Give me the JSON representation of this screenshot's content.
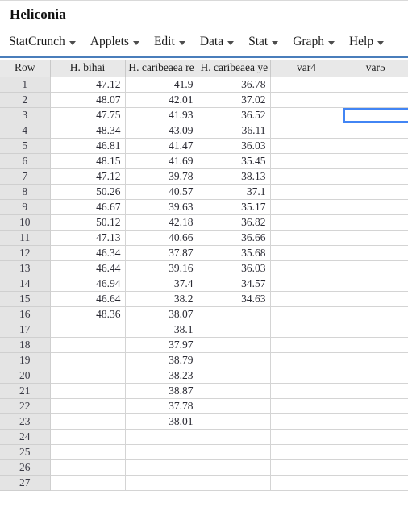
{
  "window": {
    "title": "Heliconia"
  },
  "menu": {
    "items": [
      {
        "label": "StatCrunch",
        "icon": "chevron-down-icon"
      },
      {
        "label": "Applets",
        "icon": "chevron-down-icon"
      },
      {
        "label": "Edit",
        "icon": "chevron-down-icon"
      },
      {
        "label": "Data",
        "icon": "chevron-down-icon"
      },
      {
        "label": "Stat",
        "icon": "chevron-down-icon"
      },
      {
        "label": "Graph",
        "icon": "chevron-down-icon"
      },
      {
        "label": "Help",
        "icon": "chevron-down-icon"
      }
    ]
  },
  "colors": {
    "accent": "#4a7ebb",
    "selection": "#4285f4",
    "header_bg": "#e8e8e8",
    "rownum_bg": "#e4e4e4",
    "grid_line": "#d4d4d4"
  },
  "spreadsheet": {
    "columns": [
      "Row",
      "H. bihai",
      "H. caribeaea re",
      "H. caribeaea ye",
      "var4",
      "var5"
    ],
    "selected_cell": {
      "row": 3,
      "column": "var5"
    },
    "rows": [
      {
        "n": "1",
        "c1": "47.12",
        "c2": "41.9",
        "c3": "36.78",
        "c4": "",
        "c5": ""
      },
      {
        "n": "2",
        "c1": "48.07",
        "c2": "42.01",
        "c3": "37.02",
        "c4": "",
        "c5": ""
      },
      {
        "n": "3",
        "c1": "47.75",
        "c2": "41.93",
        "c3": "36.52",
        "c4": "",
        "c5": ""
      },
      {
        "n": "4",
        "c1": "48.34",
        "c2": "43.09",
        "c3": "36.11",
        "c4": "",
        "c5": ""
      },
      {
        "n": "5",
        "c1": "46.81",
        "c2": "41.47",
        "c3": "36.03",
        "c4": "",
        "c5": ""
      },
      {
        "n": "6",
        "c1": "48.15",
        "c2": "41.69",
        "c3": "35.45",
        "c4": "",
        "c5": ""
      },
      {
        "n": "7",
        "c1": "47.12",
        "c2": "39.78",
        "c3": "38.13",
        "c4": "",
        "c5": ""
      },
      {
        "n": "8",
        "c1": "50.26",
        "c2": "40.57",
        "c3": "37.1",
        "c4": "",
        "c5": ""
      },
      {
        "n": "9",
        "c1": "46.67",
        "c2": "39.63",
        "c3": "35.17",
        "c4": "",
        "c5": ""
      },
      {
        "n": "10",
        "c1": "50.12",
        "c2": "42.18",
        "c3": "36.82",
        "c4": "",
        "c5": ""
      },
      {
        "n": "11",
        "c1": "47.13",
        "c2": "40.66",
        "c3": "36.66",
        "c4": "",
        "c5": ""
      },
      {
        "n": "12",
        "c1": "46.34",
        "c2": "37.87",
        "c3": "35.68",
        "c4": "",
        "c5": ""
      },
      {
        "n": "13",
        "c1": "46.44",
        "c2": "39.16",
        "c3": "36.03",
        "c4": "",
        "c5": ""
      },
      {
        "n": "14",
        "c1": "46.94",
        "c2": "37.4",
        "c3": "34.57",
        "c4": "",
        "c5": ""
      },
      {
        "n": "15",
        "c1": "46.64",
        "c2": "38.2",
        "c3": "34.63",
        "c4": "",
        "c5": ""
      },
      {
        "n": "16",
        "c1": "48.36",
        "c2": "38.07",
        "c3": "",
        "c4": "",
        "c5": ""
      },
      {
        "n": "17",
        "c1": "",
        "c2": "38.1",
        "c3": "",
        "c4": "",
        "c5": ""
      },
      {
        "n": "18",
        "c1": "",
        "c2": "37.97",
        "c3": "",
        "c4": "",
        "c5": ""
      },
      {
        "n": "19",
        "c1": "",
        "c2": "38.79",
        "c3": "",
        "c4": "",
        "c5": ""
      },
      {
        "n": "20",
        "c1": "",
        "c2": "38.23",
        "c3": "",
        "c4": "",
        "c5": ""
      },
      {
        "n": "21",
        "c1": "",
        "c2": "38.87",
        "c3": "",
        "c4": "",
        "c5": ""
      },
      {
        "n": "22",
        "c1": "",
        "c2": "37.78",
        "c3": "",
        "c4": "",
        "c5": ""
      },
      {
        "n": "23",
        "c1": "",
        "c2": "38.01",
        "c3": "",
        "c4": "",
        "c5": ""
      },
      {
        "n": "24",
        "c1": "",
        "c2": "",
        "c3": "",
        "c4": "",
        "c5": ""
      },
      {
        "n": "25",
        "c1": "",
        "c2": "",
        "c3": "",
        "c4": "",
        "c5": ""
      },
      {
        "n": "26",
        "c1": "",
        "c2": "",
        "c3": "",
        "c4": "",
        "c5": ""
      },
      {
        "n": "27",
        "c1": "",
        "c2": "",
        "c3": "",
        "c4": "",
        "c5": ""
      }
    ]
  }
}
